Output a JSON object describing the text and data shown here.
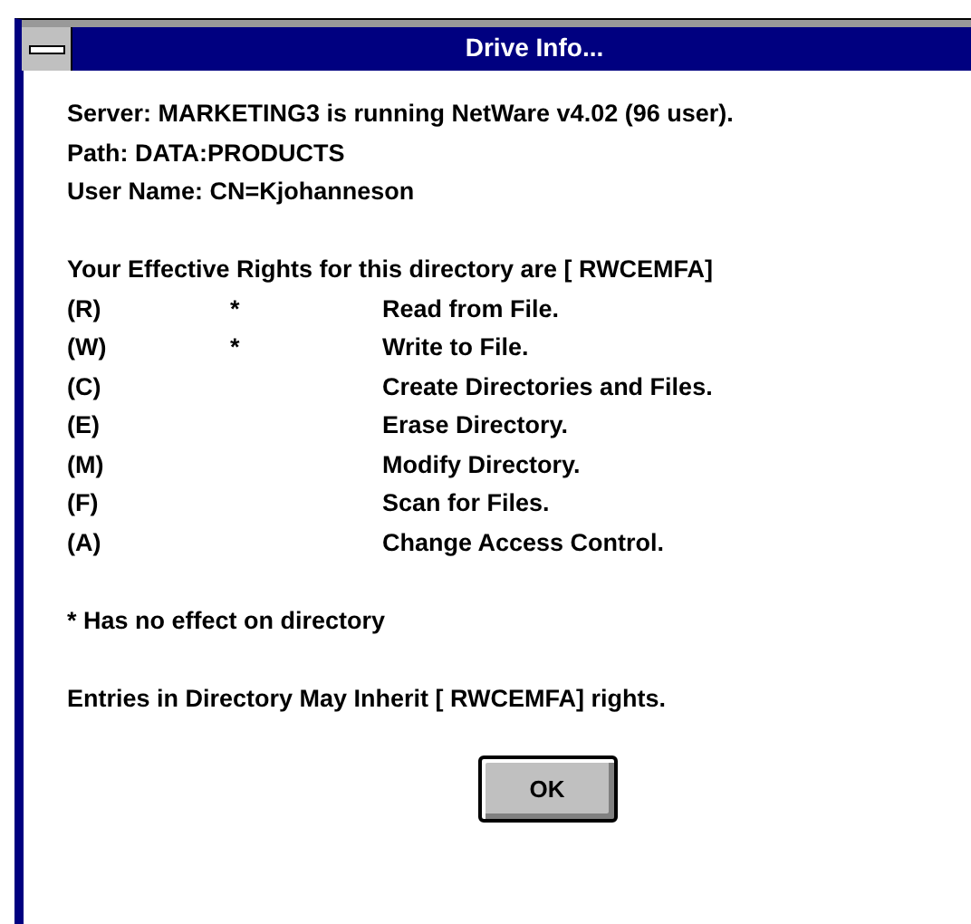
{
  "window": {
    "title": "Drive Info..."
  },
  "info_lines": [
    "Server:  MARKETING3  is running NetWare v4.02 (96 user).",
    "Path:  DATA:PRODUCTS",
    "User Name:  CN=Kjohanneson"
  ],
  "rights_heading": "Your Effective Rights for this directory are [ RWCEMFA]",
  "rights": [
    {
      "code": "(R)",
      "note": "*",
      "description": "Read from File."
    },
    {
      "code": "(W)",
      "note": "*",
      "description": "Write to File."
    },
    {
      "code": "(C)",
      "description": "Create Directories and Files."
    },
    {
      "code": "(E)",
      "description": "Erase Directory."
    },
    {
      "code": "(M)",
      "description": "Modify Directory."
    },
    {
      "code": "(F)",
      "description": "Scan for Files."
    },
    {
      "code": "(A)",
      "description": "Change Access Control."
    }
  ],
  "footnote": "* Has no effect on directory",
  "inherit_note": "Entries in Directory May Inherit [ RWCEMFA] rights.",
  "buttons": [
    "OK"
  ]
}
